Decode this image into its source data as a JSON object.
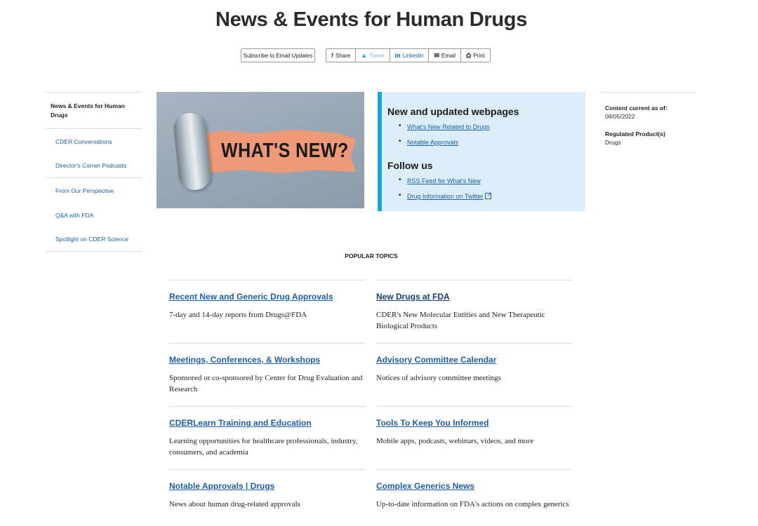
{
  "page": {
    "title": "News & Events for Human Drugs"
  },
  "toolbar": {
    "subscribe_label": "Subscribe to Email Updates",
    "share_buttons": [
      {
        "icon": "facebook-icon",
        "glyph": "f",
        "label": "Share"
      },
      {
        "icon": "twitter-icon",
        "glyph": "🐦",
        "label": "Tweet"
      },
      {
        "icon": "linkedin-icon",
        "glyph": "in",
        "label": "Linkedin"
      },
      {
        "icon": "email-icon",
        "glyph": "✉",
        "label": "Email"
      },
      {
        "icon": "print-icon",
        "glyph": "⎙",
        "label": "Print"
      }
    ]
  },
  "leftnav": {
    "heading": "News & Events for Human Drugs",
    "items": [
      "CDER Conversations",
      "Director's Corner Podcasts",
      "From Our Perspective",
      "Q&A with FDA",
      "Spotlight on CDER Science"
    ]
  },
  "hero": {
    "text": "WHAT'S NEW?"
  },
  "infobox": {
    "section1_title": "New and updated webpages",
    "section1_links": [
      "What's New Related to Drugs",
      "Notable Approvals"
    ],
    "section2_title": "Follow us",
    "section2_links": [
      "RSS Feed for What's New ",
      "Drug Information on Twitter"
    ]
  },
  "meta": {
    "content_label": "Content current as of:",
    "content_date": "08/05/2022",
    "regulated_label": "Regulated Product(s)",
    "regulated_value": "Drugs"
  },
  "popular": {
    "heading": "POPULAR TOPICS",
    "topics": [
      {
        "title": "Recent New and Generic Drug Approvals",
        "desc": "7-day and 14-day reports from Drugs@FDA"
      },
      {
        "title": "New Drugs at FDA",
        "desc": "CDER's New Molecular Entities and New Therapeutic Biological Products"
      },
      {
        "title": "Meetings, Conferences, & Workshops",
        "desc": "Sponsored or co-sponsored by Center for Drug Evaluation and Research"
      },
      {
        "title": "Advisory Committee Calendar",
        "desc": "Notices of advisory committee meetings"
      },
      {
        "title": "CDERLearn Training and Education",
        "desc": "Learning opportunities for healthcare professionals, industry, consumers, and academia"
      },
      {
        "title": "Tools To Keep You Informed",
        "desc": "Mobile apps, podcasts, webinars, videos, and more"
      },
      {
        "title": "Notable Approvals | Drugs",
        "desc": "News about human drug-related approvals"
      },
      {
        "title": "Complex Generics News",
        "desc": "Up-to-date information on FDA's actions on complex generics"
      }
    ]
  }
}
